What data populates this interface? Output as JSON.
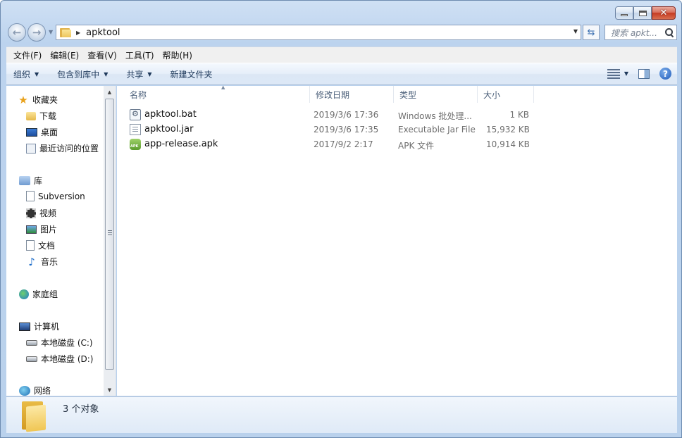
{
  "window": {
    "caption_buttons": {
      "minimize": "minimize",
      "maximize": "maximize",
      "close": "✕"
    }
  },
  "address": {
    "crumb": "apktool",
    "search_placeholder": "搜索 apkt...",
    "refresh_icon": "refresh-icon"
  },
  "menubar": {
    "items": [
      "文件(F)",
      "编辑(E)",
      "查看(V)",
      "工具(T)",
      "帮助(H)"
    ]
  },
  "commandbar": {
    "items": [
      "组织",
      "包含到库中",
      "共享",
      "新建文件夹"
    ]
  },
  "navpane": {
    "favorites": "收藏夹",
    "downloads": "下载",
    "desktop": "桌面",
    "recent": "最近访问的位置",
    "libraries": "库",
    "subversion": "Subversion",
    "videos": "视频",
    "pictures": "图片",
    "documents": "文档",
    "music": "音乐",
    "homegroup": "家庭组",
    "computer": "计算机",
    "drive_c": "本地磁盘 (C:)",
    "drive_d": "本地磁盘 (D:)",
    "network": "网络"
  },
  "filelist": {
    "columns": [
      "名称",
      "修改日期",
      "类型",
      "大小"
    ],
    "rows": [
      {
        "name": "apktool.bat",
        "date": "2019/3/6 17:36",
        "type": "Windows 批处理...",
        "size": "1 KB"
      },
      {
        "name": "apktool.jar",
        "date": "2019/3/6 17:35",
        "type": "Executable Jar File",
        "size": "15,932 KB"
      },
      {
        "name": "app-release.apk",
        "date": "2017/9/2 2:17",
        "type": "APK 文件",
        "size": "10,914 KB"
      }
    ]
  },
  "details": {
    "count_text": "3 个对象"
  }
}
